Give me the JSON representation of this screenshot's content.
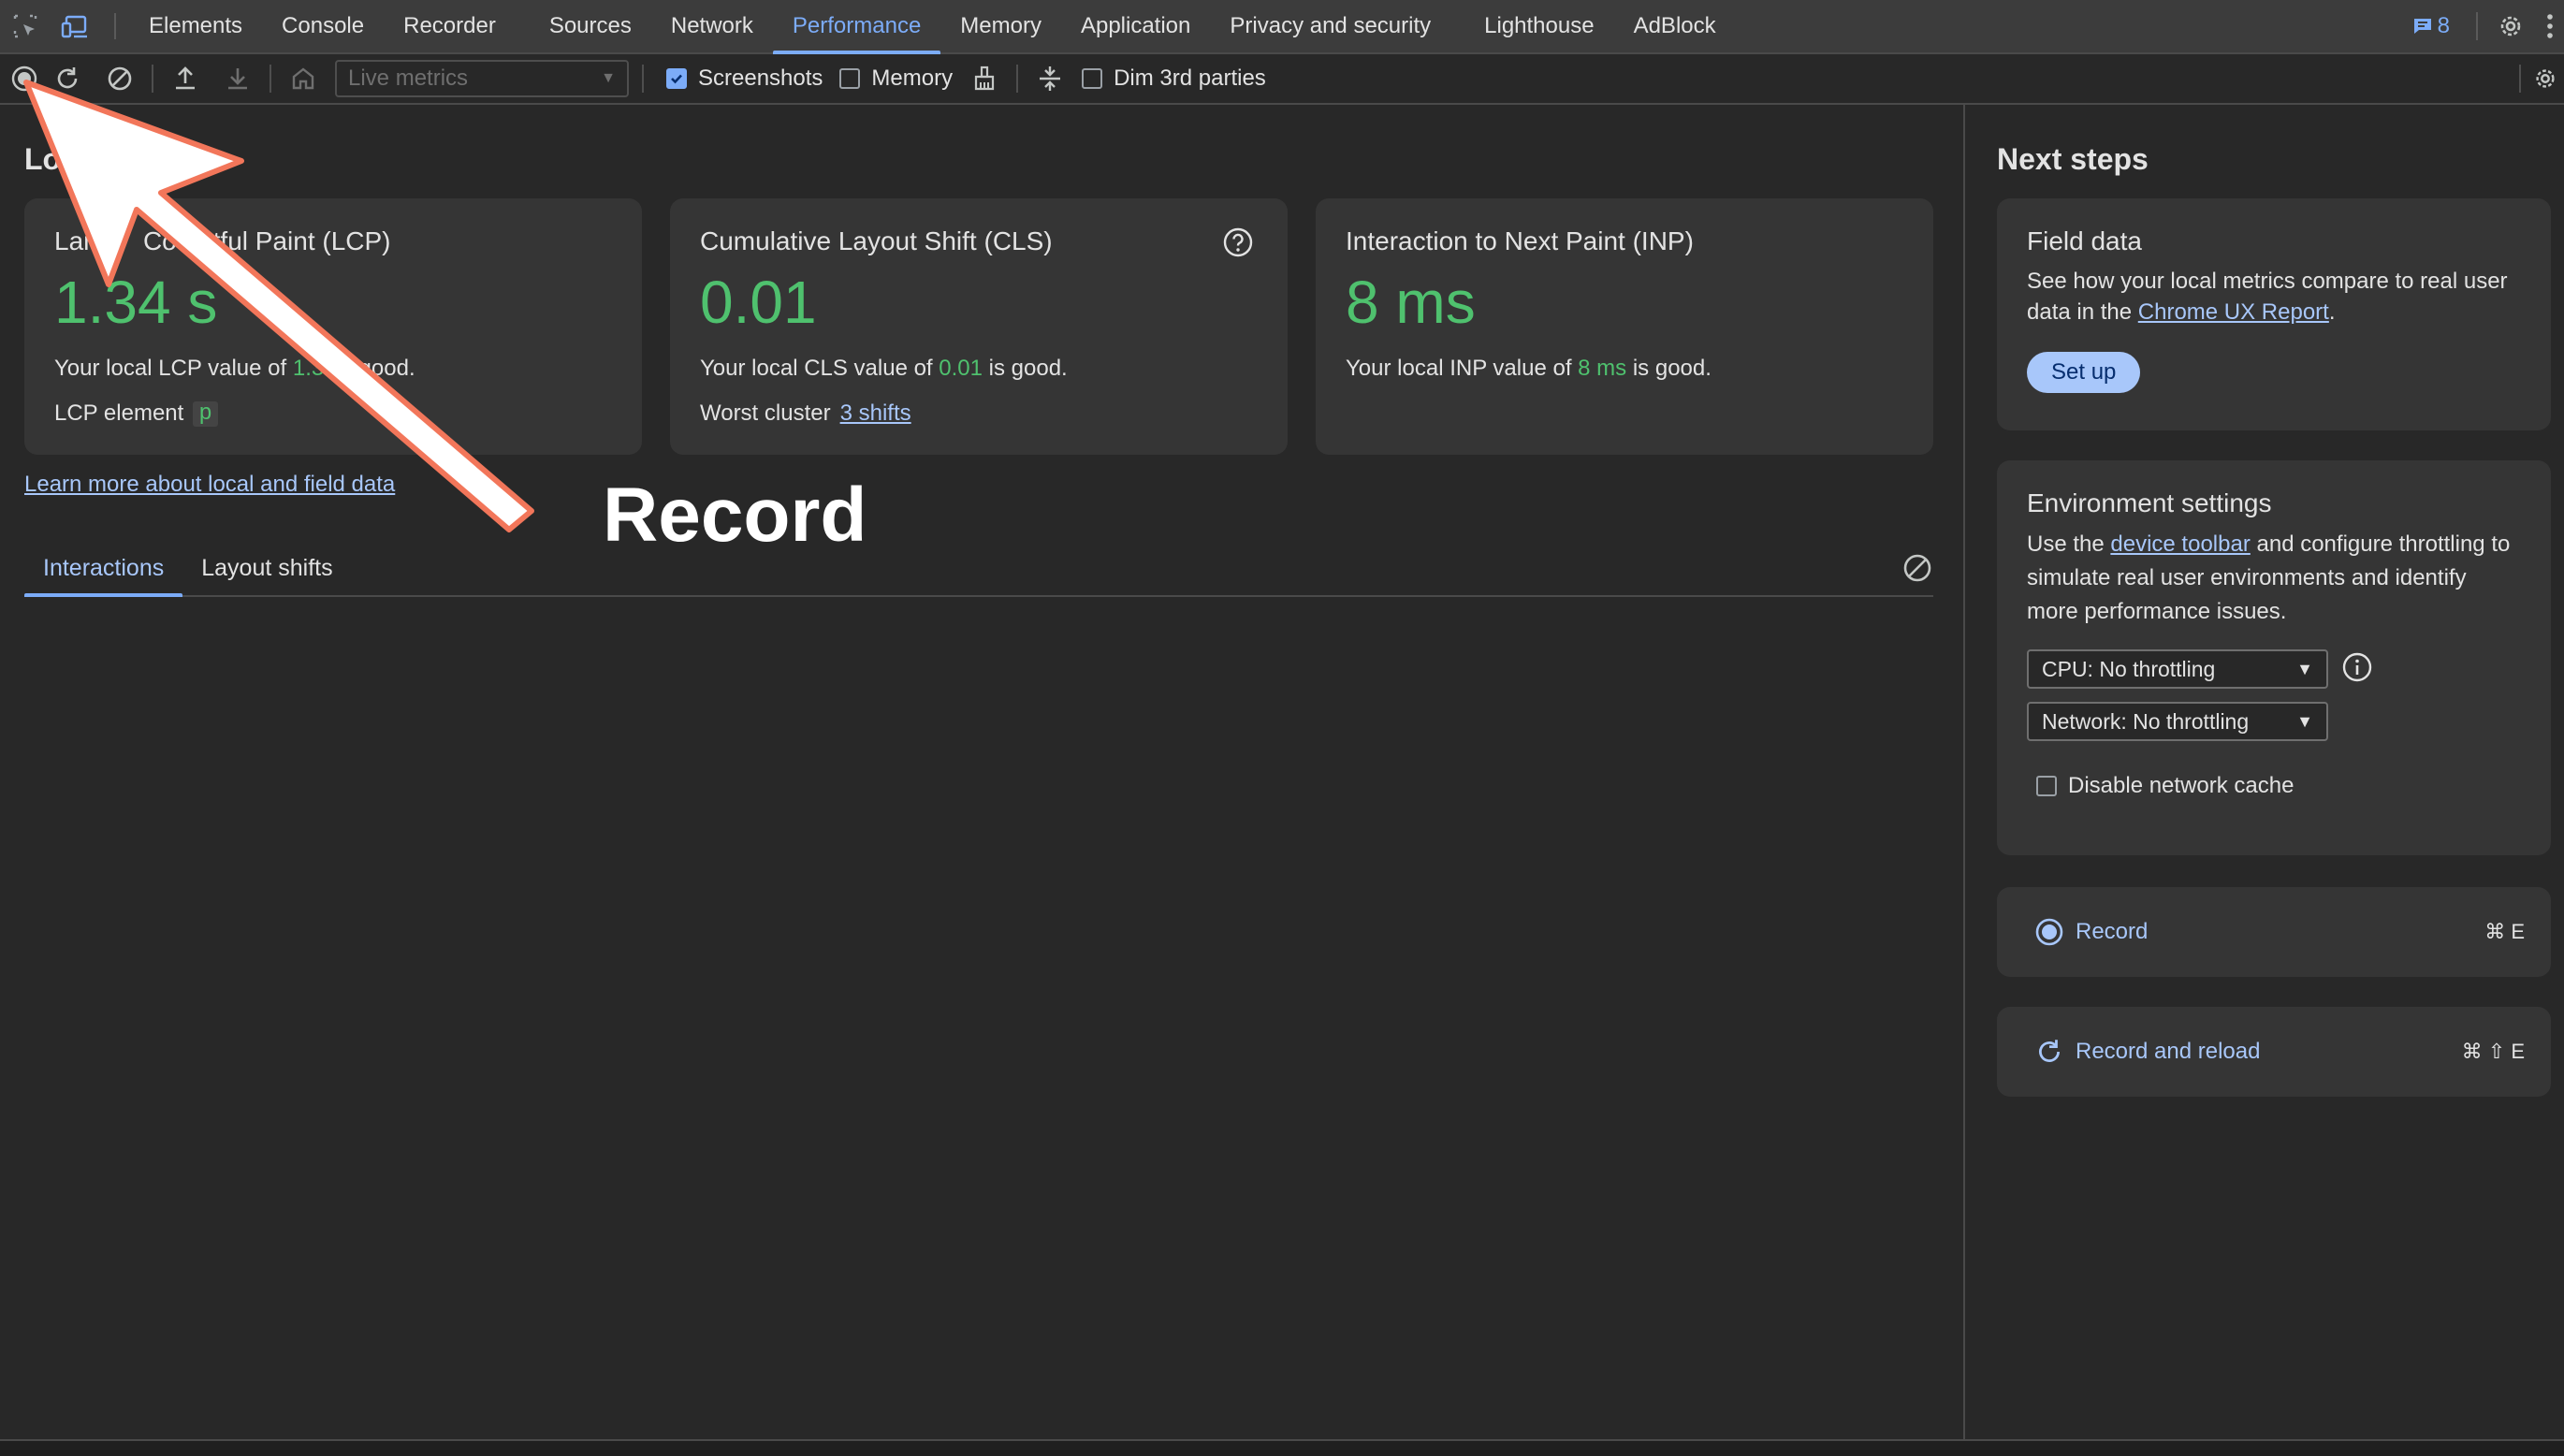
{
  "tabbar": {
    "tabs": [
      "Elements",
      "Console",
      "Recorder",
      "Sources",
      "Network",
      "Performance",
      "Memory",
      "Application",
      "Privacy and security",
      "Lighthouse",
      "AdBlock"
    ],
    "active_tab": "Performance",
    "issues_count": "8"
  },
  "toolbar": {
    "mode_select": "Live metrics",
    "screenshots_label": "Screenshots",
    "screenshots_checked": true,
    "memory_label": "Memory",
    "memory_checked": false,
    "dim_label": "Dim 3rd parties",
    "dim_checked": false
  },
  "main": {
    "section_title": "Loc",
    "cards": [
      {
        "title": "Large   Co   ntful Paint (LCP)",
        "value": "1.34 s",
        "desc_prefix": "Your local LCP value of ",
        "desc_value": "1.3",
        "desc_suffix": "  is good.",
        "extra_label": "LCP element",
        "extra_value": "p"
      },
      {
        "title": "Cumulative Layout Shift (CLS)",
        "value": "0.01",
        "desc_prefix": "Your local CLS value of ",
        "desc_value": "0.01",
        "desc_suffix": " is good.",
        "extra_label": "Worst cluster",
        "extra_value": "3 shifts"
      },
      {
        "title": "Interaction to Next Paint (INP)",
        "value": "8 ms",
        "desc_prefix": "Your local INP value of ",
        "desc_value": "8 ms",
        "desc_suffix": " is good."
      }
    ],
    "learn_link": "Learn more about local and field data",
    "subtabs": [
      "Interactions",
      "Layout shifts"
    ],
    "active_subtab": "Interactions"
  },
  "sidebar": {
    "title": "Next steps",
    "field_data": {
      "title": "Field data",
      "text_before": "See how your local metrics compare to real user data in the ",
      "link": "Chrome UX Report",
      "text_after": ".",
      "button": "Set up"
    },
    "environment": {
      "title": "Environment settings",
      "text_before": "Use the ",
      "link": "device toolbar",
      "text_after": " and configure throttling to simulate real user environments and identify more performance issues.",
      "cpu_select": "CPU: No throttling",
      "network_select": "Network: No throttling",
      "disable_cache_label": "Disable network cache"
    },
    "record": {
      "label": "Record",
      "shortcut": "⌘ E"
    },
    "record_reload": {
      "label": "Record and reload",
      "shortcut": "⌘ ⇧ E"
    }
  },
  "annotation": {
    "label": "Record",
    "color": "#f2765a"
  },
  "colors": {
    "accent": "#7cacf8",
    "good": "#4fc16e",
    "link": "#a8c7fa"
  }
}
